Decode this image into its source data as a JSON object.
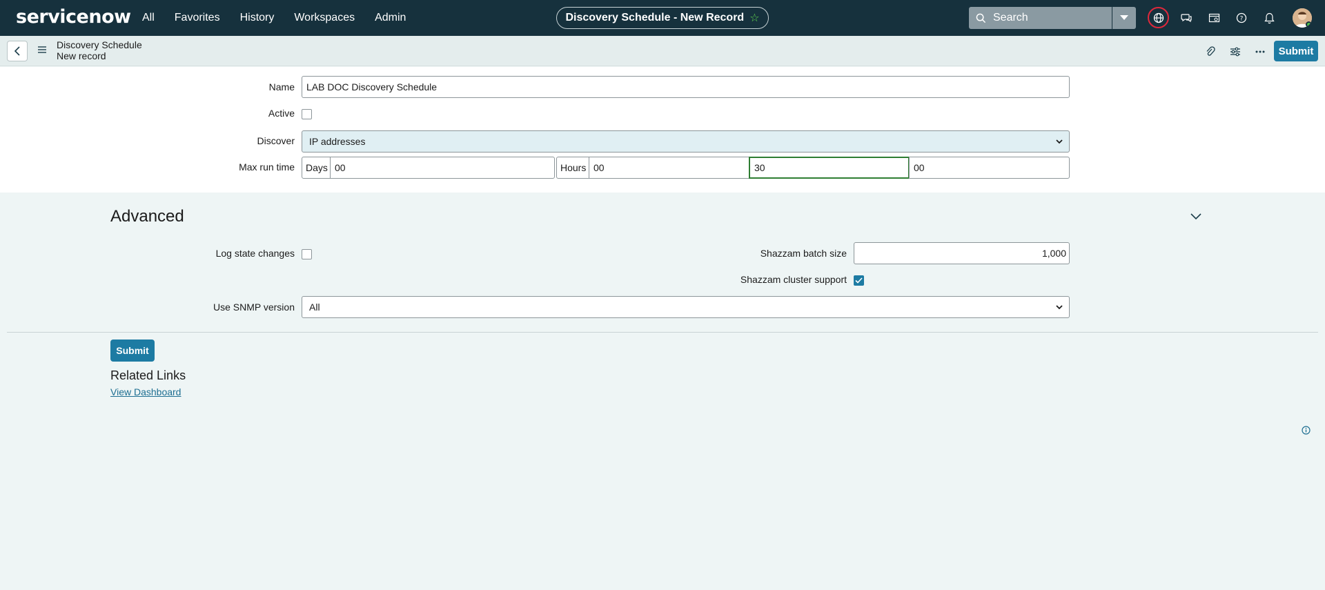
{
  "nav": {
    "logo": "servicenow",
    "menu": [
      "All",
      "Favorites",
      "History",
      "Workspaces",
      "Admin"
    ],
    "record_title": "Discovery Schedule - New Record",
    "search_placeholder": "Search"
  },
  "header": {
    "breadcrumb_table": "Discovery Schedule",
    "breadcrumb_record": "New record",
    "submit_label": "Submit"
  },
  "form": {
    "name_label": "Name",
    "name_value": "LAB DOC Discovery Schedule",
    "active_label": "Active",
    "active_checked": false,
    "discover_label": "Discover",
    "discover_value": "IP addresses",
    "max_run_label": "Max run time",
    "days_label": "Days",
    "days_value": "00",
    "hours_label": "Hours",
    "hours_value": "00",
    "minutes_value": "30",
    "seconds_value": "00"
  },
  "advanced": {
    "title": "Advanced",
    "log_state_label": "Log state changes",
    "log_state_checked": false,
    "batch_label": "Shazzam batch size",
    "batch_value": "1,000",
    "cluster_label": "Shazzam cluster support",
    "cluster_checked": true,
    "snmp_label": "Use SNMP version",
    "snmp_value": "All"
  },
  "footer": {
    "submit_label": "Submit",
    "related_title": "Related Links",
    "view_dashboard": "View Dashboard"
  },
  "colors": {
    "nav_bg": "#16313d",
    "primary": "#1d7ba3",
    "page_bg": "#eef5f5"
  }
}
